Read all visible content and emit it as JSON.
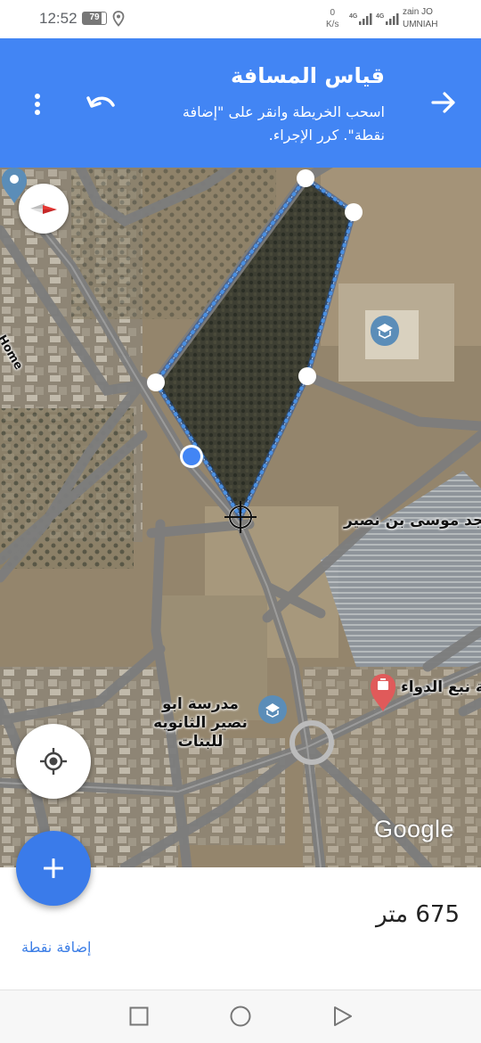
{
  "status_bar": {
    "time": "12:52",
    "battery": "79",
    "net_speed_value": "0",
    "net_speed_unit": "K/s",
    "signal_1": "4G",
    "signal_2": "4G",
    "carrier_1": "zain JO",
    "carrier_2": "UMNIAH"
  },
  "header": {
    "title": "قياس المسافة",
    "subtitle": "اسحب الخريطة وانقر على \"إضافة نقطة\". كرر الإجراء.",
    "background_color": "#4285f4"
  },
  "map": {
    "labels": {
      "mosque": "سجد موسى بن نصير",
      "school": "مدرسة ابو نصير الثانويه للبنات",
      "pharmacy": "ية نبع الدواء",
      "left_fragment": "Home"
    },
    "attribution": "Google",
    "measure_line_color": "#4a90e2"
  },
  "bottom": {
    "distance_value": "675",
    "distance_unit": "متر",
    "add_point_label": "إضافة نقطة"
  },
  "icons": {
    "back": "arrow-right-icon",
    "undo": "undo-icon",
    "menu": "more-vert-icon",
    "compass": "compass-icon",
    "locate": "my-location-icon",
    "add": "plus-icon"
  }
}
